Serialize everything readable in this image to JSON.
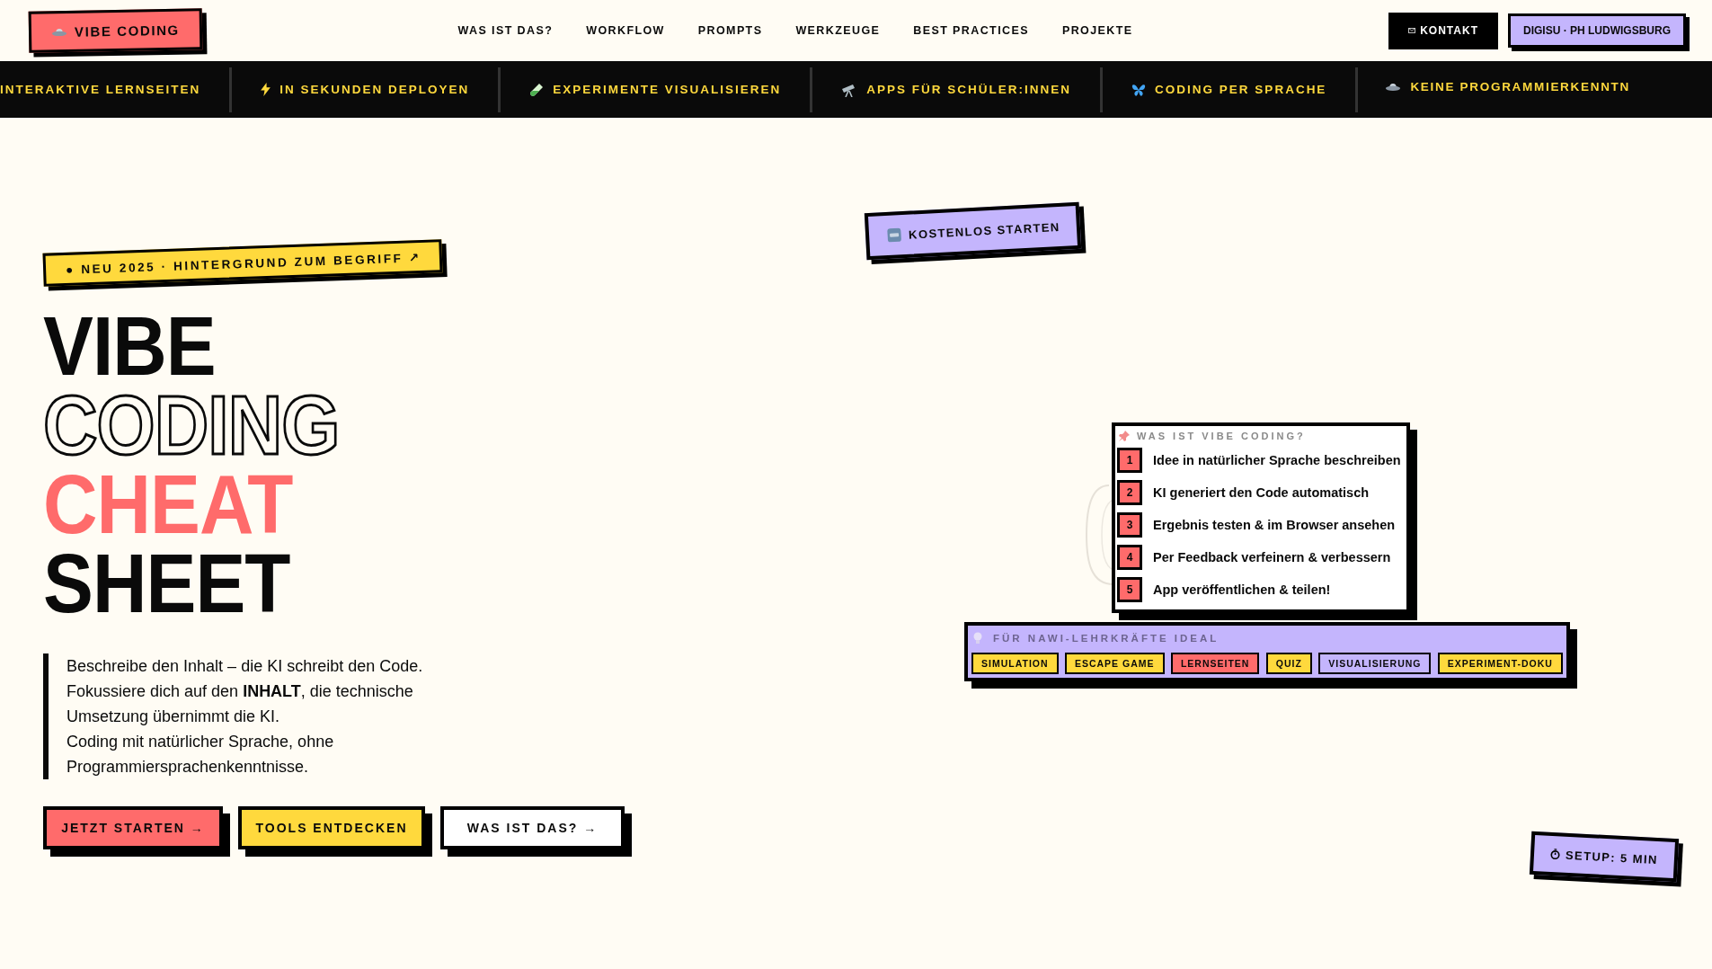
{
  "nav": {
    "logo": "VIBE CODING",
    "links": [
      "WAS IST DAS?",
      "WORKFLOW",
      "PROMPTS",
      "WERKZEUGE",
      "BEST PRACTICES",
      "PROJEKTE"
    ],
    "contact": "KONTAKT",
    "institution": "DIGISU · PH LUDWIGSBURG"
  },
  "ticker": [
    {
      "text": "INTERAKTIVE LERNSEITEN"
    },
    {
      "text": "IN SEKUNDEN DEPLOYEN"
    },
    {
      "text": "EXPERIMENTE VISUALISIEREN"
    },
    {
      "text": "APPS FÜR SCHÜLER:INNEN"
    },
    {
      "text": "CODING PER SPRACHE"
    },
    {
      "text": "KEINE PROGRAMMIERKENNTN"
    }
  ],
  "hero": {
    "badge": "● NEU 2025 · HINTERGRUND ZUM BEGRIFF ↗",
    "title": [
      {
        "text": "VIBE",
        "kind": "solid"
      },
      {
        "text": "CODING",
        "kind": "outline"
      },
      {
        "text": "CHEAT",
        "kind": "accent"
      },
      {
        "text": "SHEET",
        "kind": "solid"
      }
    ],
    "intro": [
      "Beschreibe den Inhalt – die KI schreibt den Code.",
      "Fokussiere dich auf den **INHALT**, die technische Umsetzung übernimmt die KI.",
      "Coding mit natürlicher Sprache, ohne Programmiersprachenkenntnisse."
    ],
    "buttons": [
      {
        "label": "JETZT STARTEN →",
        "kind": "primary"
      },
      {
        "label": "TOOLS ENTDECKEN",
        "kind": "secondary"
      },
      {
        "label": "WAS IST DAS? →",
        "kind": "outline"
      }
    ]
  },
  "stickers": {
    "free": "KOSTENLOS STARTEN",
    "setup": "SETUP: 5 MIN"
  },
  "card": {
    "title": "WAS IST VIBE CODING?",
    "steps": [
      {
        "number": "1",
        "text": "Idee in natürlicher Sprache beschreiben"
      },
      {
        "number": "2",
        "text": "KI generiert den Code automatisch"
      },
      {
        "number": "3",
        "text": "Ergebnis testen & im Browser ansehen"
      },
      {
        "number": "4",
        "text": "Per Feedback verfeinern & verbessern"
      },
      {
        "number": "5",
        "text": "App veröffentlichen & teilen!"
      }
    ]
  },
  "audience": {
    "title": "FÜR NAWI-LEHRKRÄFTE IDEAL",
    "tags": [
      {
        "label": "SIMULATION",
        "color": "#ffd93d"
      },
      {
        "label": "ESCAPE GAME",
        "color": "#ffd93d"
      },
      {
        "label": "LERNSEITEN",
        "color": "#ff6b6b"
      },
      {
        "label": "QUIZ",
        "color": "#ffd93d"
      },
      {
        "label": "VISUALISIERUNG",
        "color": "#c4b5fd"
      },
      {
        "label": "EXPERIMENT-DOKU",
        "color": "#ffd93d"
      }
    ]
  }
}
